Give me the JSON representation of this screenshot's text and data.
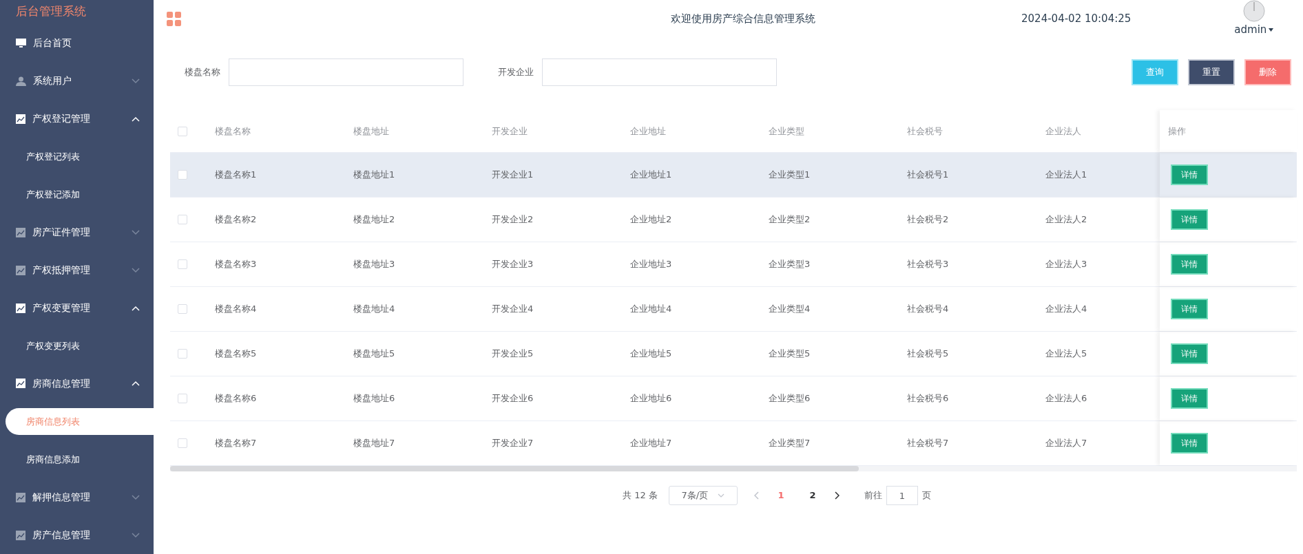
{
  "sidebar": {
    "title": "后台管理系统",
    "items": [
      {
        "kind": "link",
        "label": "后台首页"
      },
      {
        "kind": "group",
        "label": "系统用户",
        "expanded": false
      },
      {
        "kind": "group",
        "label": "产权登记管理",
        "expanded": true,
        "children": [
          {
            "label": "产权登记列表",
            "selected": false
          },
          {
            "label": "产权登记添加",
            "selected": false
          }
        ]
      },
      {
        "kind": "group",
        "label": "房产证件管理",
        "expanded": false
      },
      {
        "kind": "group",
        "label": "产权抵押管理",
        "expanded": false
      },
      {
        "kind": "group",
        "label": "产权变更管理",
        "expanded": true,
        "children": [
          {
            "label": "产权变更列表",
            "selected": false
          }
        ]
      },
      {
        "kind": "group",
        "label": "房商信息管理",
        "expanded": true,
        "children": [
          {
            "label": "房商信息列表",
            "selected": true
          },
          {
            "label": "房商信息添加",
            "selected": false
          }
        ]
      },
      {
        "kind": "group",
        "label": "解押信息管理",
        "expanded": false
      },
      {
        "kind": "group",
        "label": "房产信息管理",
        "expanded": false
      }
    ]
  },
  "header": {
    "title": "欢迎使用房产综合信息管理系统",
    "datetime": "2024-04-02 10:04:25",
    "user": "admin"
  },
  "search": {
    "fields": [
      {
        "label": "楼盘名称"
      },
      {
        "label": "开发企业"
      }
    ],
    "buttons": [
      {
        "label": "查询",
        "kind": "query"
      },
      {
        "label": "重置",
        "kind": "reset"
      },
      {
        "label": "删除",
        "kind": "delete"
      }
    ]
  },
  "table": {
    "all_checked": false,
    "columns": [
      "楼盘名称",
      "楼盘地址",
      "开发企业",
      "企业地址",
      "企业类型",
      "社会税号",
      "企业法人",
      "操作"
    ],
    "rows": [
      {
        "hovered": true,
        "cells": [
          "楼盘名称1",
          "楼盘地址1",
          "开发企业1",
          "企业地址1",
          "企业类型1",
          "社会税号1",
          "企业法人1"
        ],
        "action": "详情"
      },
      {
        "hovered": false,
        "cells": [
          "楼盘名称2",
          "楼盘地址2",
          "开发企业2",
          "企业地址2",
          "企业类型2",
          "社会税号2",
          "企业法人2"
        ],
        "action": "详情"
      },
      {
        "hovered": false,
        "cells": [
          "楼盘名称3",
          "楼盘地址3",
          "开发企业3",
          "企业地址3",
          "企业类型3",
          "社会税号3",
          "企业法人3"
        ],
        "action": "详情"
      },
      {
        "hovered": false,
        "cells": [
          "楼盘名称4",
          "楼盘地址4",
          "开发企业4",
          "企业地址4",
          "企业类型4",
          "社会税号4",
          "企业法人4"
        ],
        "action": "详情"
      },
      {
        "hovered": false,
        "cells": [
          "楼盘名称5",
          "楼盘地址5",
          "开发企业5",
          "企业地址5",
          "企业类型5",
          "社会税号5",
          "企业法人5"
        ],
        "action": "详情"
      },
      {
        "hovered": false,
        "cells": [
          "楼盘名称6",
          "楼盘地址6",
          "开发企业6",
          "企业地址6",
          "企业类型6",
          "社会税号6",
          "企业法人6"
        ],
        "action": "详情"
      },
      {
        "hovered": false,
        "cells": [
          "楼盘名称7",
          "楼盘地址7",
          "开发企业7",
          "企业地址7",
          "企业类型7",
          "社会税号7",
          "企业法人7"
        ],
        "action": "详情"
      }
    ]
  },
  "pagination": {
    "total": "共 12 条",
    "page_size": "7条/页",
    "pages": [
      {
        "label": "1",
        "selected": true
      },
      {
        "label": "2",
        "selected": false
      }
    ],
    "goto_label": "前往",
    "goto_value": "1",
    "goto_suffix": "页"
  }
}
